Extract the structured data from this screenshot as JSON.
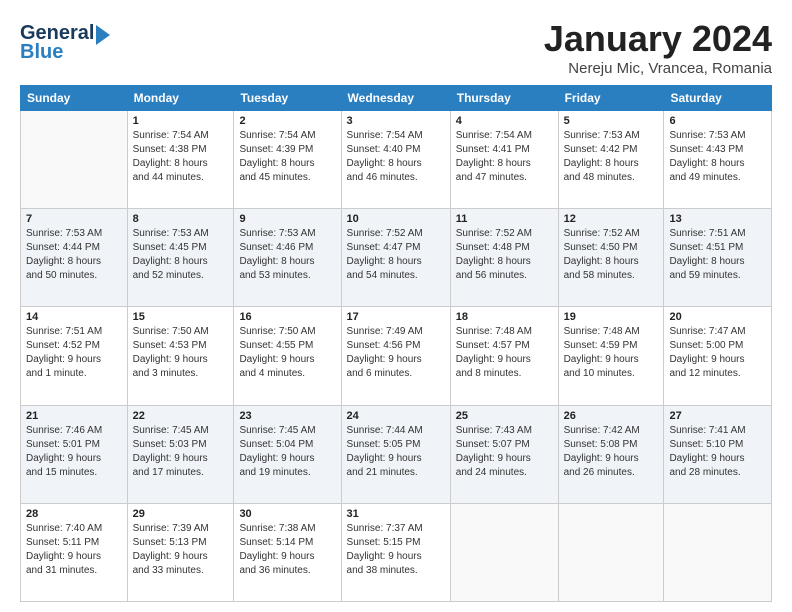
{
  "logo": {
    "text1": "General",
    "text2": "Blue"
  },
  "header": {
    "month_title": "January 2024",
    "location": "Nereju Mic, Vrancea, Romania"
  },
  "days_of_week": [
    "Sunday",
    "Monday",
    "Tuesday",
    "Wednesday",
    "Thursday",
    "Friday",
    "Saturday"
  ],
  "weeks": [
    [
      {
        "day": "",
        "info": ""
      },
      {
        "day": "1",
        "info": "Sunrise: 7:54 AM\nSunset: 4:38 PM\nDaylight: 8 hours\nand 44 minutes."
      },
      {
        "day": "2",
        "info": "Sunrise: 7:54 AM\nSunset: 4:39 PM\nDaylight: 8 hours\nand 45 minutes."
      },
      {
        "day": "3",
        "info": "Sunrise: 7:54 AM\nSunset: 4:40 PM\nDaylight: 8 hours\nand 46 minutes."
      },
      {
        "day": "4",
        "info": "Sunrise: 7:54 AM\nSunset: 4:41 PM\nDaylight: 8 hours\nand 47 minutes."
      },
      {
        "day": "5",
        "info": "Sunrise: 7:53 AM\nSunset: 4:42 PM\nDaylight: 8 hours\nand 48 minutes."
      },
      {
        "day": "6",
        "info": "Sunrise: 7:53 AM\nSunset: 4:43 PM\nDaylight: 8 hours\nand 49 minutes."
      }
    ],
    [
      {
        "day": "7",
        "info": "Sunrise: 7:53 AM\nSunset: 4:44 PM\nDaylight: 8 hours\nand 50 minutes."
      },
      {
        "day": "8",
        "info": "Sunrise: 7:53 AM\nSunset: 4:45 PM\nDaylight: 8 hours\nand 52 minutes."
      },
      {
        "day": "9",
        "info": "Sunrise: 7:53 AM\nSunset: 4:46 PM\nDaylight: 8 hours\nand 53 minutes."
      },
      {
        "day": "10",
        "info": "Sunrise: 7:52 AM\nSunset: 4:47 PM\nDaylight: 8 hours\nand 54 minutes."
      },
      {
        "day": "11",
        "info": "Sunrise: 7:52 AM\nSunset: 4:48 PM\nDaylight: 8 hours\nand 56 minutes."
      },
      {
        "day": "12",
        "info": "Sunrise: 7:52 AM\nSunset: 4:50 PM\nDaylight: 8 hours\nand 58 minutes."
      },
      {
        "day": "13",
        "info": "Sunrise: 7:51 AM\nSunset: 4:51 PM\nDaylight: 8 hours\nand 59 minutes."
      }
    ],
    [
      {
        "day": "14",
        "info": "Sunrise: 7:51 AM\nSunset: 4:52 PM\nDaylight: 9 hours\nand 1 minute."
      },
      {
        "day": "15",
        "info": "Sunrise: 7:50 AM\nSunset: 4:53 PM\nDaylight: 9 hours\nand 3 minutes."
      },
      {
        "day": "16",
        "info": "Sunrise: 7:50 AM\nSunset: 4:55 PM\nDaylight: 9 hours\nand 4 minutes."
      },
      {
        "day": "17",
        "info": "Sunrise: 7:49 AM\nSunset: 4:56 PM\nDaylight: 9 hours\nand 6 minutes."
      },
      {
        "day": "18",
        "info": "Sunrise: 7:48 AM\nSunset: 4:57 PM\nDaylight: 9 hours\nand 8 minutes."
      },
      {
        "day": "19",
        "info": "Sunrise: 7:48 AM\nSunset: 4:59 PM\nDaylight: 9 hours\nand 10 minutes."
      },
      {
        "day": "20",
        "info": "Sunrise: 7:47 AM\nSunset: 5:00 PM\nDaylight: 9 hours\nand 12 minutes."
      }
    ],
    [
      {
        "day": "21",
        "info": "Sunrise: 7:46 AM\nSunset: 5:01 PM\nDaylight: 9 hours\nand 15 minutes."
      },
      {
        "day": "22",
        "info": "Sunrise: 7:45 AM\nSunset: 5:03 PM\nDaylight: 9 hours\nand 17 minutes."
      },
      {
        "day": "23",
        "info": "Sunrise: 7:45 AM\nSunset: 5:04 PM\nDaylight: 9 hours\nand 19 minutes."
      },
      {
        "day": "24",
        "info": "Sunrise: 7:44 AM\nSunset: 5:05 PM\nDaylight: 9 hours\nand 21 minutes."
      },
      {
        "day": "25",
        "info": "Sunrise: 7:43 AM\nSunset: 5:07 PM\nDaylight: 9 hours\nand 24 minutes."
      },
      {
        "day": "26",
        "info": "Sunrise: 7:42 AM\nSunset: 5:08 PM\nDaylight: 9 hours\nand 26 minutes."
      },
      {
        "day": "27",
        "info": "Sunrise: 7:41 AM\nSunset: 5:10 PM\nDaylight: 9 hours\nand 28 minutes."
      }
    ],
    [
      {
        "day": "28",
        "info": "Sunrise: 7:40 AM\nSunset: 5:11 PM\nDaylight: 9 hours\nand 31 minutes."
      },
      {
        "day": "29",
        "info": "Sunrise: 7:39 AM\nSunset: 5:13 PM\nDaylight: 9 hours\nand 33 minutes."
      },
      {
        "day": "30",
        "info": "Sunrise: 7:38 AM\nSunset: 5:14 PM\nDaylight: 9 hours\nand 36 minutes."
      },
      {
        "day": "31",
        "info": "Sunrise: 7:37 AM\nSunset: 5:15 PM\nDaylight: 9 hours\nand 38 minutes."
      },
      {
        "day": "",
        "info": ""
      },
      {
        "day": "",
        "info": ""
      },
      {
        "day": "",
        "info": ""
      }
    ]
  ]
}
